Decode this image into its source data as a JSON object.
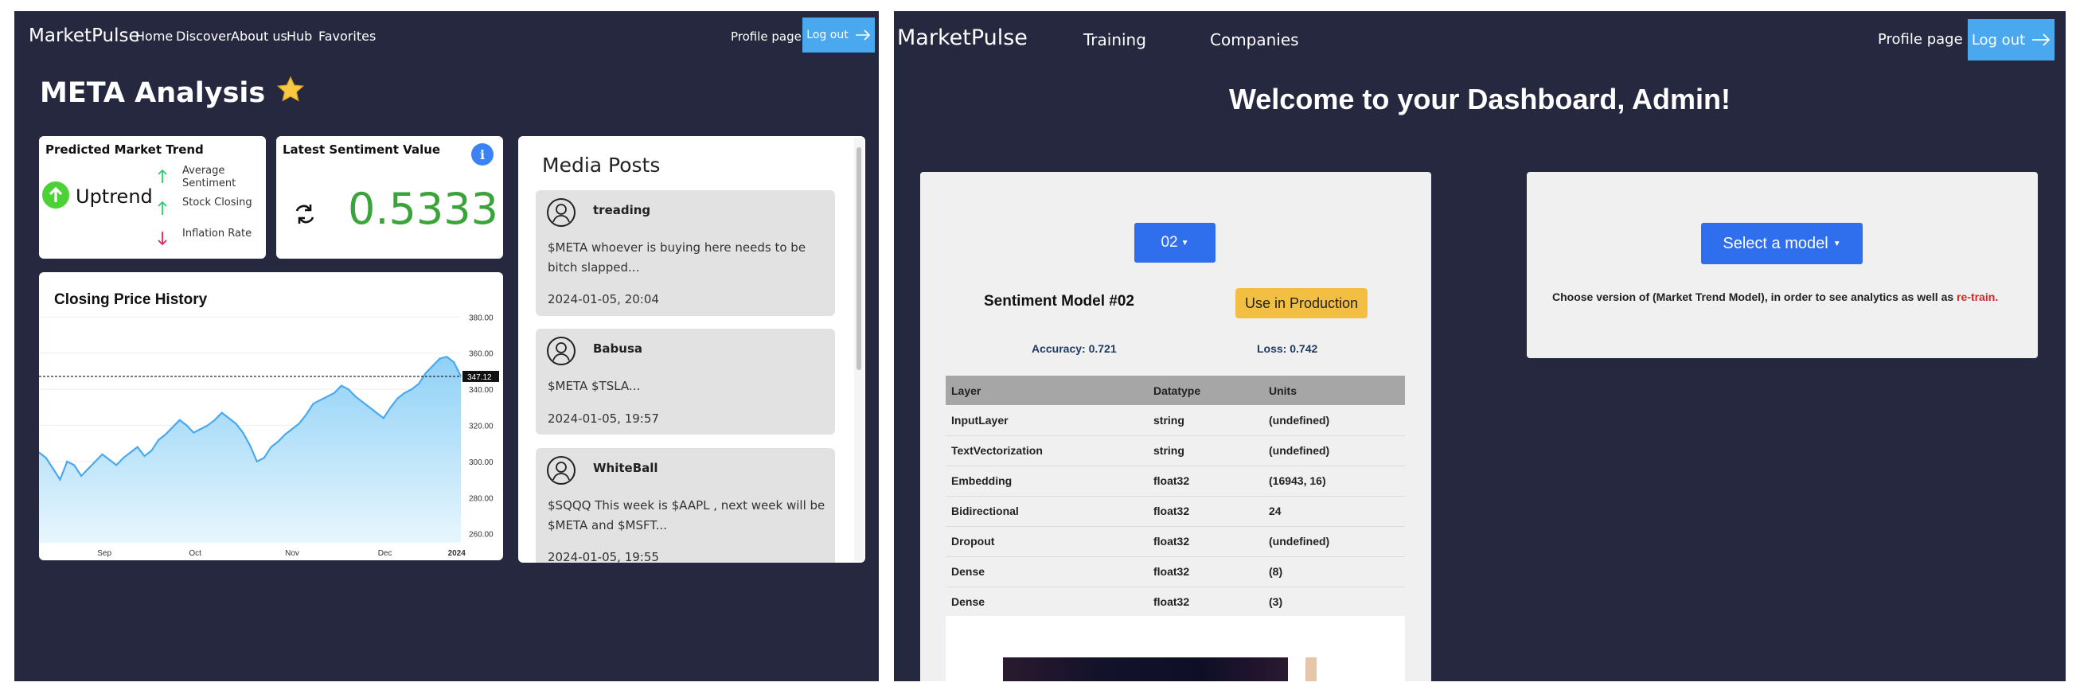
{
  "left": {
    "nav": {
      "brand": "MarketPulse",
      "links": [
        "Home",
        "Discover",
        "About us",
        "Hub",
        "Favorites"
      ],
      "profile": "Profile page",
      "logout": "Log out"
    },
    "title": "META Analysis",
    "title_icon": "star-icon",
    "trend_card": {
      "title": "Predicted Market Trend",
      "value": "Uptrend",
      "indicators": [
        {
          "label": "Average Sentiment",
          "direction": "up",
          "color": "#2ecc71"
        },
        {
          "label": "Stock Closing",
          "direction": "up",
          "color": "#2ecc71"
        },
        {
          "label": "Inflation Rate",
          "direction": "down",
          "color": "#e0245e"
        }
      ]
    },
    "sentiment_card": {
      "title": "Latest Sentiment Value",
      "value": "0.5333",
      "info": "i"
    },
    "price_card": {
      "title": "Closing Price History"
    },
    "media": {
      "title": "Media Posts",
      "posts": [
        {
          "author": "treading",
          "text": "$META whoever is buying here needs to be bitch slapped...",
          "date": "2024-01-05, 20:04"
        },
        {
          "author": "Babusa",
          "text": "$META $TSLA...",
          "date": "2024-01-05, 19:57"
        },
        {
          "author": "WhiteBall",
          "text": "$SQQQ This week is $AAPL , next week will be $META and $MSFT...",
          "date": "2024-01-05, 19:55"
        }
      ]
    }
  },
  "chart_data": {
    "type": "area",
    "title": "Closing Price History",
    "xlabel": "",
    "ylabel": "",
    "x_ticks": [
      "Sep",
      "Oct",
      "Nov",
      "Dec",
      "2024"
    ],
    "y_ticks": [
      260,
      280,
      300,
      320,
      340,
      360,
      380
    ],
    "ylim": [
      255,
      385
    ],
    "last_value_label": "347.12",
    "series": [
      {
        "values": [
          305,
          302,
          296,
          290,
          300,
          298,
          292,
          296,
          300,
          304,
          301,
          298,
          302,
          305,
          308,
          303,
          306,
          312,
          315,
          319,
          323,
          320,
          316,
          318,
          320,
          323,
          327,
          324,
          321,
          316,
          309,
          300,
          302,
          308,
          311,
          315,
          318,
          321,
          326,
          332,
          334,
          336,
          338,
          342,
          340,
          336,
          333,
          330,
          327,
          324,
          330,
          335,
          338,
          340,
          343,
          349,
          353,
          357,
          358,
          355,
          347.12
        ]
      }
    ],
    "grid": true,
    "colors": {
      "line": "#4aa8ee",
      "fill_top": "#8fd1f7",
      "fill_bottom": "#e8f6fd"
    }
  },
  "right": {
    "nav": {
      "brand": "MarketPulse",
      "links": [
        "Training",
        "Companies"
      ],
      "profile": "Profile page",
      "logout": "Log out"
    },
    "welcome": "Welcome to your Dashboard, Admin!",
    "model_card": {
      "version": "02",
      "model_title": "Sentiment Model #02",
      "production_button": "Use in Production",
      "accuracy": "Accuracy: 0.721",
      "loss": "Loss: 0.742",
      "columns": [
        "Layer",
        "Datatype",
        "Units"
      ],
      "rows": [
        [
          "InputLayer",
          "string",
          "(undefined)"
        ],
        [
          "TextVectorization",
          "string",
          "(undefined)"
        ],
        [
          "Embedding",
          "float32",
          "(16943, 16)"
        ],
        [
          "Bidirectional",
          "float32",
          "24"
        ],
        [
          "Dropout",
          "float32",
          "(undefined)"
        ],
        [
          "Dense",
          "float32",
          "(8)"
        ],
        [
          "Dense",
          "float32",
          "(3)"
        ]
      ]
    },
    "select_card": {
      "button": "Select a model",
      "text": "Choose version of (Market Trend Model), in order to see analytics as well as ",
      "text_red": "re-train."
    }
  }
}
